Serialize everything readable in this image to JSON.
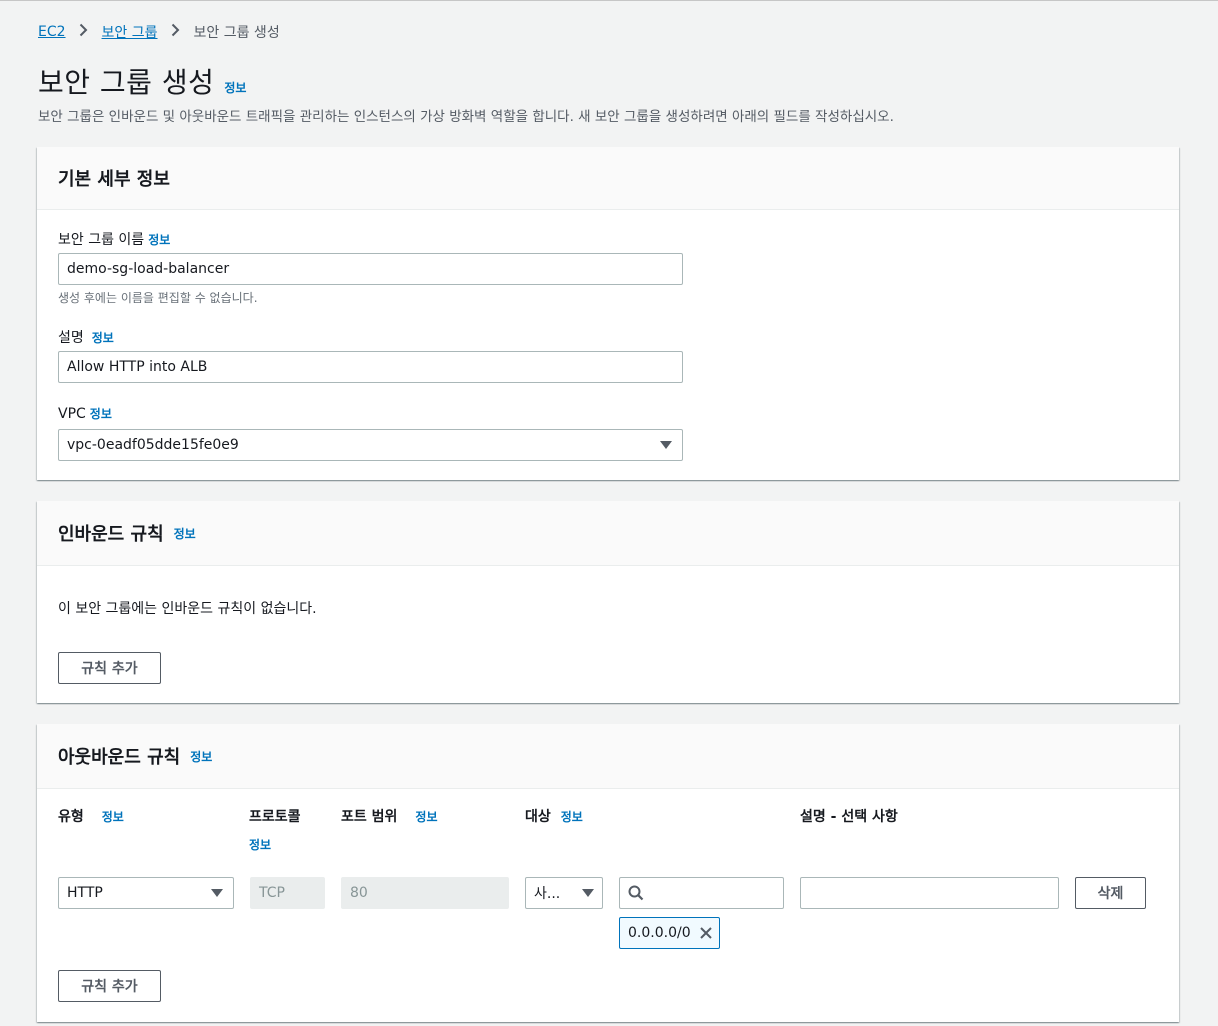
{
  "breadcrumb": {
    "items": [
      "EC2",
      "보안 그룹"
    ],
    "current": "보안 그룹 생성"
  },
  "page": {
    "title": "보안 그룹 생성",
    "info": "정보",
    "description": "보안 그룹은 인바운드 및 아웃바운드 트래픽을 관리하는 인스턴스의 가상 방화벽 역할을 합니다. 새 보안 그룹을 생성하려면 아래의 필드를 작성하십시오."
  },
  "basic": {
    "heading": "기본 세부 정보",
    "name_label": "보안 그룹 이름",
    "name_value": "demo-sg-load-balancer",
    "name_hint": "생성 후에는 이름을 편집할 수 없습니다.",
    "desc_label": "설명",
    "desc_value": "Allow HTTP into ALB",
    "vpc_label": "VPC",
    "vpc_value": "vpc-0eadf05dde15fe0e9",
    "info": "정보"
  },
  "inbound": {
    "heading": "인바운드 규칙",
    "info": "정보",
    "empty_text": "이 보안 그룹에는 인바운드 규칙이 없습니다.",
    "add_button": "규칙 추가"
  },
  "outbound": {
    "heading": "아웃바운드 규칙",
    "info": "정보",
    "columns": {
      "type": "유형",
      "protocol": "프로토콜",
      "port": "포트 범위",
      "dest": "대상",
      "desc": "설명 - 선택 사항"
    },
    "row": {
      "type": "HTTP",
      "protocol": "TCP",
      "port": "80",
      "dest_select": "사...",
      "search_value": "",
      "desc_value": "",
      "cidr": "0.0.0.0/0",
      "delete_button": "삭제"
    },
    "add_button": "규칙 추가"
  },
  "colors": {
    "link": "#0073bb",
    "background": "#f2f3f3",
    "text": "#16191f"
  }
}
